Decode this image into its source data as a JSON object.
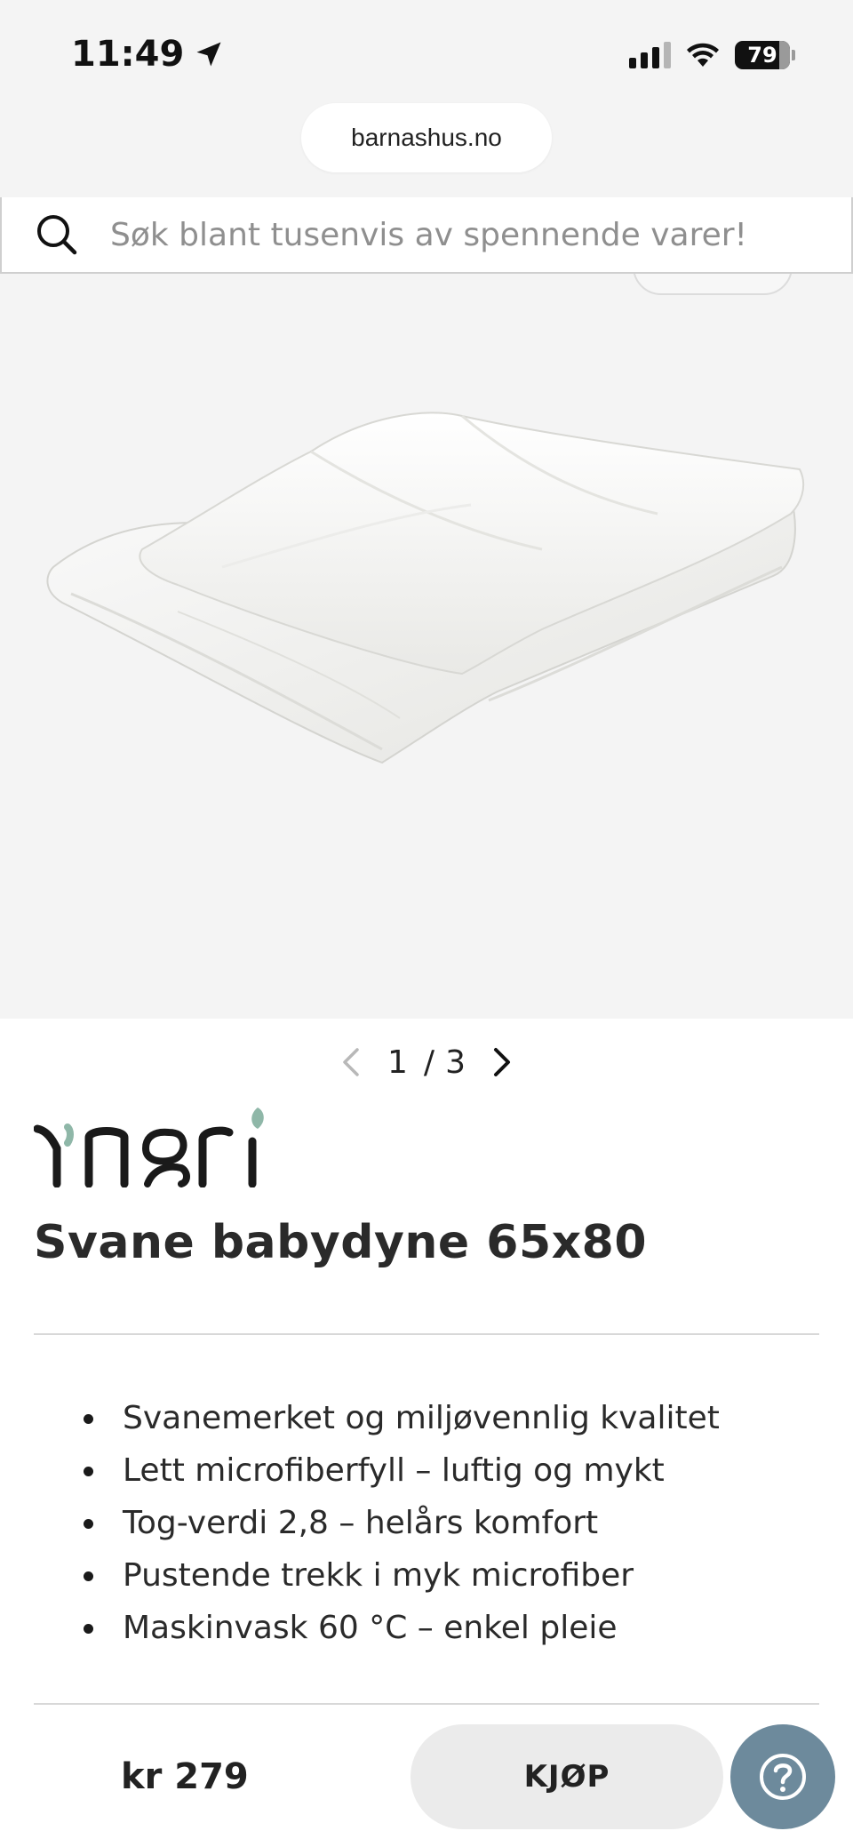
{
  "status_bar": {
    "time": "11:49",
    "battery": "79",
    "icons": [
      "location-arrow-icon",
      "signal-icon",
      "wifi-icon",
      "battery-icon"
    ]
  },
  "browser": {
    "url": "barnashus.no"
  },
  "search": {
    "placeholder": "Søk blant tusenvis av spennende varer!"
  },
  "gallery": {
    "current": "1",
    "separator": "/",
    "total": "3"
  },
  "product": {
    "brand": "Yngri",
    "title": "Svane babydyne 65x80",
    "features": [
      "Svanemerket og miljøvennlig kvalitet",
      "Lett microfiberfyll – luftig og mykt",
      "Tog-verdi 2,8 – helårs komfort",
      "Pustende trekk i myk microfiber",
      "Maskinvask 60 °C – enkel pleie"
    ]
  },
  "purchase_bar": {
    "price": "kr 279",
    "buy_label": "KJØP"
  },
  "colors": {
    "help_button": "#6d8a9c",
    "buy_button": "#ebebeb",
    "logo_leaf": "#8fb7a8"
  }
}
